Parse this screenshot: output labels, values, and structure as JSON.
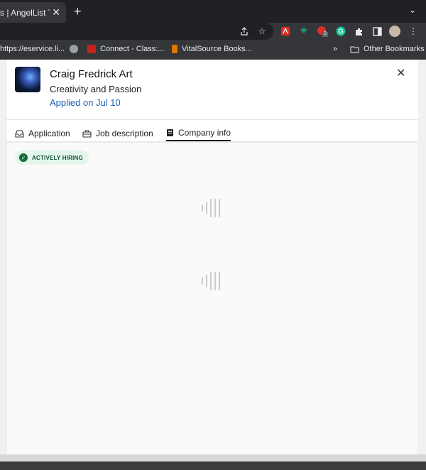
{
  "browser": {
    "tab_title": "s | AngelList Ta",
    "tab_close": "✕",
    "new_tab": "+",
    "tab_menu": "⌄",
    "bookmarks": [
      {
        "label": "https://eservice.li...",
        "color": "#5f6368"
      },
      {
        "label": "",
        "color": "#9aa0a6"
      },
      {
        "label": "Connect - Class:...",
        "color": "#c5221f"
      },
      {
        "label": "VitalSource Books...",
        "color": "#e37400"
      }
    ],
    "bookmarks_more": "»",
    "other_bookmarks": "Other Bookmarks",
    "extension_badge": "2"
  },
  "panel": {
    "company_name": "Craig Fredrick Art",
    "tagline": "Creativity and Passion",
    "applied": "Applied on Jul 10",
    "close": "✕",
    "tabs": [
      {
        "label": "Application",
        "icon": "inbox-icon",
        "active": false
      },
      {
        "label": "Job description",
        "icon": "briefcase-icon",
        "active": false
      },
      {
        "label": "Company info",
        "icon": "building-icon",
        "active": true
      }
    ],
    "status_badge": "ACTIVELY HIRING",
    "status_color": "#156b3b"
  }
}
